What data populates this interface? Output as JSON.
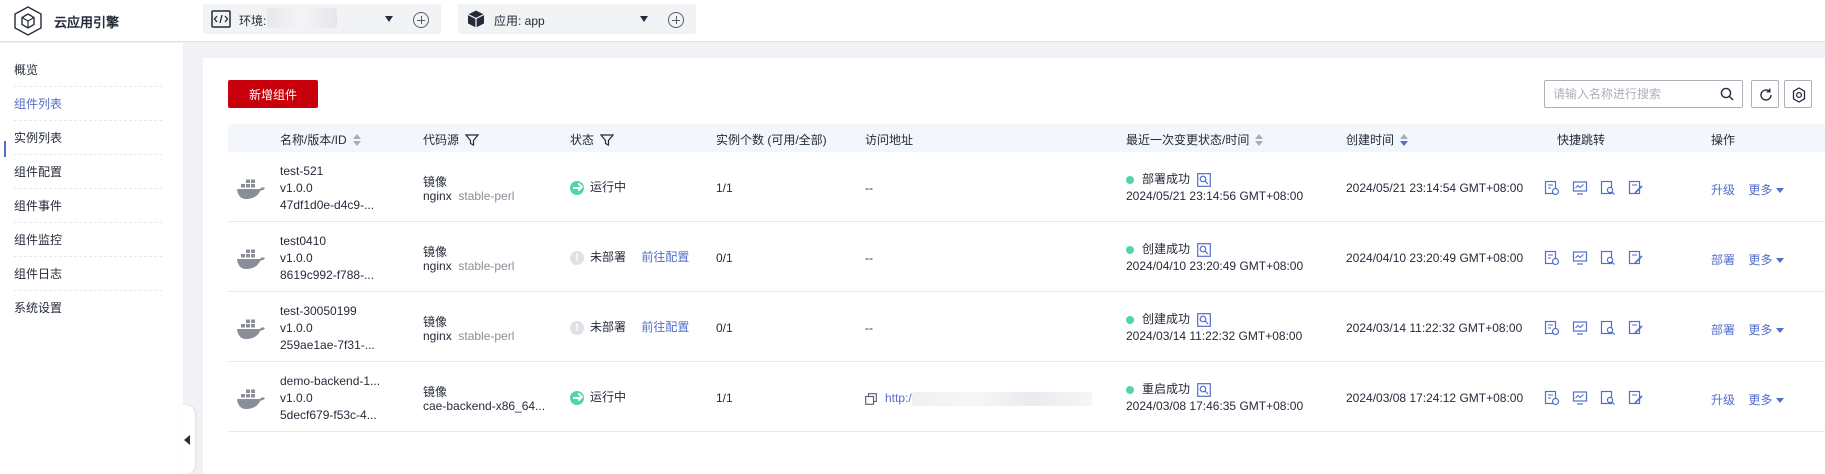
{
  "header": {
    "app_title": "云应用引擎",
    "env_label": "环境:",
    "app_label": "应用: app"
  },
  "sidebar": {
    "items": [
      {
        "label": "概览"
      },
      {
        "label": "组件列表"
      },
      {
        "label": "实例列表"
      },
      {
        "label": "组件配置"
      },
      {
        "label": "组件事件"
      },
      {
        "label": "组件监控"
      },
      {
        "label": "组件日志"
      },
      {
        "label": "系统设置"
      }
    ],
    "active_index": 1
  },
  "toolbar": {
    "add_label": "新增组件",
    "search_placeholder": "请输入名称进行搜索"
  },
  "table": {
    "headers": {
      "name": "名称/版本/ID",
      "source": "代码源",
      "status": "状态",
      "instances": "实例个数 (可用/全部)",
      "address": "访问地址",
      "last_change": "最近一次变更状态/时间",
      "created": "创建时间",
      "quick": "快捷跳转",
      "ops": "操作"
    },
    "rows": [
      {
        "name": "test-521",
        "version": "v1.0.0",
        "id": "47df1d0e-d4c9-...",
        "source_type": "镜像",
        "image": "nginx",
        "tag": "stable-perl",
        "status": "运行中",
        "status_kind": "running",
        "config_link": "",
        "instances": "1/1",
        "address": "--",
        "address_prefix": "",
        "change_status": "部署成功",
        "change_time": "2024/05/21 23:14:56 GMT+08:00",
        "created": "2024/05/21 23:14:54 GMT+08:00",
        "op_primary": "升级",
        "op_more": "更多"
      },
      {
        "name": "test0410",
        "version": "v1.0.0",
        "id": "8619c992-f788-...",
        "source_type": "镜像",
        "image": "nginx",
        "tag": "stable-perl",
        "status": "未部署",
        "status_kind": "idle",
        "config_link": "前往配置",
        "instances": "0/1",
        "address": "--",
        "address_prefix": "",
        "change_status": "创建成功",
        "change_time": "2024/04/10 23:20:49 GMT+08:00",
        "created": "2024/04/10 23:20:49 GMT+08:00",
        "op_primary": "部署",
        "op_more": "更多"
      },
      {
        "name": "test-30050199",
        "version": "v1.0.0",
        "id": "259ae1ae-7f31-...",
        "source_type": "镜像",
        "image": "nginx",
        "tag": "stable-perl",
        "status": "未部署",
        "status_kind": "idle",
        "config_link": "前往配置",
        "instances": "0/1",
        "address": "--",
        "address_prefix": "",
        "change_status": "创建成功",
        "change_time": "2024/03/14 11:22:32 GMT+08:00",
        "created": "2024/03/14 11:22:32 GMT+08:00",
        "op_primary": "部署",
        "op_more": "更多"
      },
      {
        "name": "demo-backend-1...",
        "version": "v1.0.0",
        "id": "5decf679-f53c-4...",
        "source_type": "镜像",
        "image": "cae-backend-x86_64...",
        "tag": "",
        "status": "运行中",
        "status_kind": "running",
        "config_link": "",
        "instances": "1/1",
        "address": "",
        "address_prefix": "http:/",
        "change_status": "重启成功",
        "change_time": "2024/03/08 17:46:35 GMT+08:00",
        "created": "2024/03/08 17:24:12 GMT+08:00",
        "op_primary": "升级",
        "op_more": "更多"
      }
    ]
  },
  "colors": {
    "accent": "#526ecc",
    "primary_button": "#c7000b",
    "success": "#50d4ab"
  }
}
